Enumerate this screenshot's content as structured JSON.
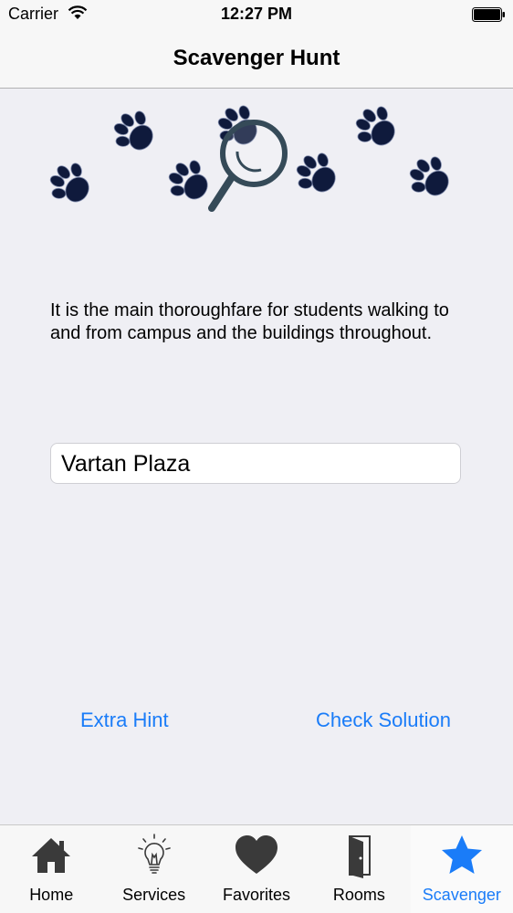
{
  "status_bar": {
    "carrier": "Carrier",
    "time": "12:27 PM"
  },
  "nav": {
    "title": "Scavenger Hunt"
  },
  "hero": {
    "icons": [
      "paw-print-icon",
      "magnifying-glass-icon"
    ],
    "paw_color": "#0f1a3c",
    "magnifier_color": "#354a58"
  },
  "clue": {
    "text": "It is the main thoroughfare for students walking to and from campus and the buildings throughout."
  },
  "answer": {
    "value": "Vartan Plaza"
  },
  "actions": {
    "extra_hint": "Extra Hint",
    "check_solution": "Check Solution"
  },
  "tabs": [
    {
      "label": "Home",
      "icon": "home-icon",
      "active": false
    },
    {
      "label": "Services",
      "icon": "lightbulb-icon",
      "active": false
    },
    {
      "label": "Favorites",
      "icon": "heart-icon",
      "active": false
    },
    {
      "label": "Rooms",
      "icon": "door-icon",
      "active": false
    },
    {
      "label": "Scavenger",
      "icon": "star-icon",
      "active": true
    }
  ],
  "colors": {
    "accent": "#1a7cf8",
    "background": "#efeff4",
    "bar": "#f7f7f7"
  }
}
